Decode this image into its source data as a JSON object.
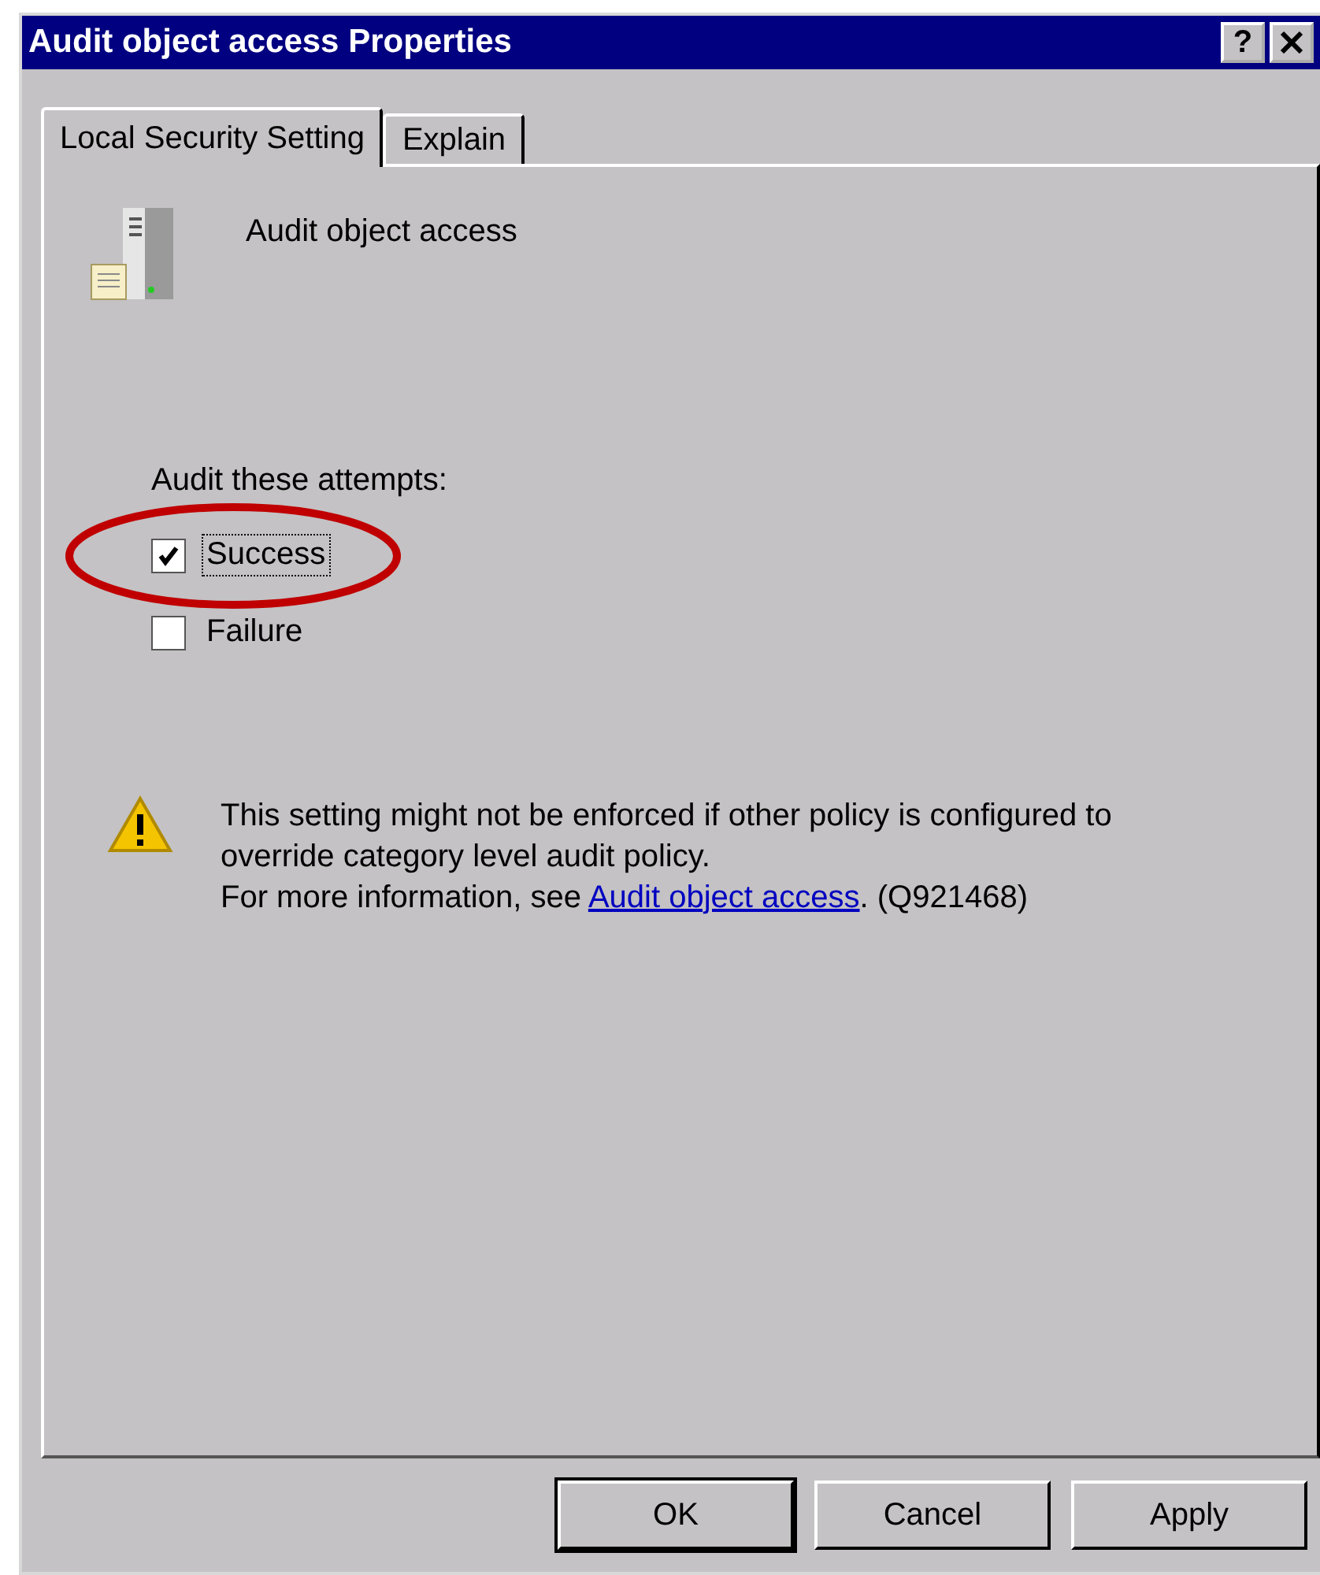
{
  "window": {
    "title": "Audit object access Properties",
    "help_button": "?"
  },
  "tabs": [
    {
      "label": "Local Security Setting",
      "selected": true
    },
    {
      "label": "Explain",
      "selected": false
    }
  ],
  "policy": {
    "name": "Audit object access"
  },
  "attempts": {
    "label": "Audit these attempts:",
    "options": [
      {
        "label": "Success",
        "checked": true,
        "focused": true
      },
      {
        "label": "Failure",
        "checked": false,
        "focused": false
      }
    ]
  },
  "annotation": {
    "kind": "ellipse",
    "color": "#c00000"
  },
  "warning": {
    "text": "This setting might not be enforced if other policy is configured to override category level audit policy.",
    "more_prefix": "For more information, see ",
    "link": "Audit object access",
    "more_suffix": ". (Q921468)"
  },
  "buttons": [
    {
      "label": "OK",
      "default": true
    },
    {
      "label": "Cancel",
      "default": false
    },
    {
      "label": "Apply",
      "default": false
    }
  ]
}
